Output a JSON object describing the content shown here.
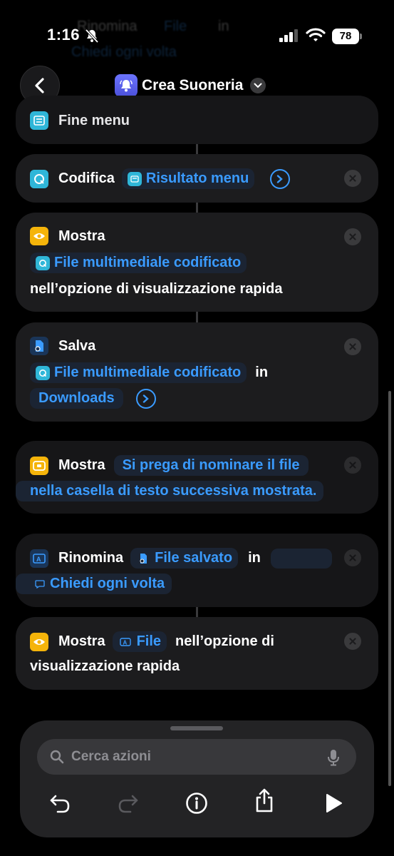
{
  "status_bar": {
    "time": "1:16",
    "battery": "78"
  },
  "ghost": {
    "action": "Rinomina",
    "token": "File",
    "preposition": "in",
    "token2": "Chiedi ogni volta"
  },
  "nav": {
    "title": "Crea Suoneria"
  },
  "actions": {
    "fine_menu": {
      "label": "Fine menu"
    },
    "codifica": {
      "verb": "Codifica",
      "token": "Risultato menu"
    },
    "mostra1": {
      "verb": "Mostra",
      "token": "File multimediale codificato",
      "suffix": "nell’opzione di visualizzazione rapida"
    },
    "salva": {
      "verb": "Salva",
      "token": "File multimediale codificato",
      "preposition": "in",
      "token2": "Downloads"
    },
    "mostra2": {
      "verb": "Mostra",
      "token_line1": "Si prega di nominare il file",
      "token_line2": "nella casella di testo successiva mostrata."
    },
    "rinomina": {
      "verb": "Rinomina",
      "token": "File salvato",
      "preposition": "in",
      "token2": "Chiedi ogni volta"
    },
    "mostra3": {
      "verb": "Mostra",
      "token": "File",
      "suffix_line1": "nell’opzione di",
      "suffix_line2": "visualizzazione rapida"
    }
  },
  "bottom": {
    "search_placeholder": "Cerca azioni"
  },
  "colors": {
    "accent": "#3a9bff",
    "card": "#1c1c1e",
    "background": "#000000"
  }
}
